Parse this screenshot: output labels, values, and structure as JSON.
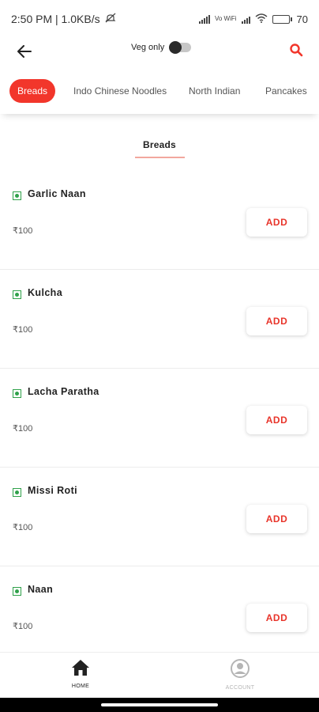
{
  "status_bar": {
    "time_speed": "2:50 PM | 1.0KB/s",
    "battery": "70",
    "battery_level": 0.7,
    "wifi_label": "Vo WiFi"
  },
  "header": {
    "veg_only_label": "Veg only",
    "veg_only_enabled": false
  },
  "categories": [
    {
      "label": "Breads",
      "active": true
    },
    {
      "label": "Indo Chinese Noodles",
      "active": false
    },
    {
      "label": "North Indian",
      "active": false
    },
    {
      "label": "Pancakes",
      "active": false
    }
  ],
  "section": {
    "title": "Breads"
  },
  "items": [
    {
      "name": "Garlic Naan",
      "price": "₹100",
      "add_label": "ADD"
    },
    {
      "name": "Kulcha",
      "price": "₹100",
      "add_label": "ADD"
    },
    {
      "name": "Lacha Paratha",
      "price": "₹100",
      "add_label": "ADD"
    },
    {
      "name": "Missi Roti",
      "price": "₹100",
      "add_label": "ADD"
    },
    {
      "name": "Naan",
      "price": "₹100",
      "add_label": "ADD"
    }
  ],
  "bottom_nav": {
    "home_label": "HOME",
    "account_label": "ACCOUNT"
  },
  "colors": {
    "accent": "#f2362b",
    "veg_green": "#2fa14a",
    "add_text": "#e8342a"
  },
  "icons": [
    "back-arrow-icon",
    "search-icon",
    "veg-indicator-icon",
    "home-icon",
    "account-icon",
    "signal-icon",
    "wifi-icon",
    "battery-icon",
    "mute-icon"
  ]
}
